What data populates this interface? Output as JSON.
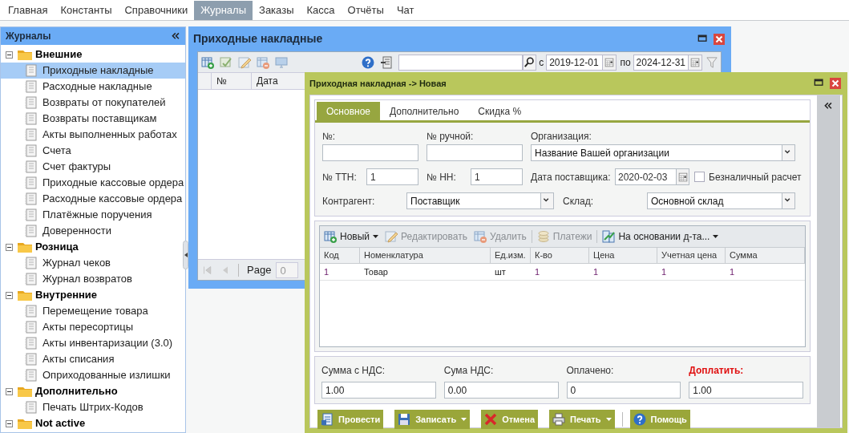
{
  "menu": [
    {
      "label": "Главная",
      "selected": false
    },
    {
      "label": "Константы",
      "selected": false
    },
    {
      "label": "Справочники",
      "selected": false
    },
    {
      "label": "Журналы",
      "selected": true
    },
    {
      "label": "Заказы",
      "selected": false
    },
    {
      "label": "Касса",
      "selected": false
    },
    {
      "label": "Отчёты",
      "selected": false
    },
    {
      "label": "Чат",
      "selected": false
    }
  ],
  "sidebar": {
    "title": "Журналы",
    "tree": [
      {
        "label": "Внешние",
        "expanded": true,
        "children": [
          {
            "label": "Приходные накладные",
            "selected": true
          },
          {
            "label": "Расходные накладные",
            "selected": false
          },
          {
            "label": "Возвраты от покупателей",
            "selected": false
          },
          {
            "label": "Возвраты поставщикам",
            "selected": false
          },
          {
            "label": "Акты выполненных работах",
            "selected": false
          },
          {
            "label": "Счета",
            "selected": false
          },
          {
            "label": "Счет фактуры",
            "selected": false
          },
          {
            "label": "Приходные кассовые ордера",
            "selected": false
          },
          {
            "label": "Расходные кассовые ордера",
            "selected": false
          },
          {
            "label": "Платёжные поручения",
            "selected": false
          },
          {
            "label": "Доверенности",
            "selected": false
          }
        ]
      },
      {
        "label": "Розница",
        "expanded": true,
        "children": [
          {
            "label": "Журнал чеков",
            "selected": false
          },
          {
            "label": "Журнал возвратов",
            "selected": false
          }
        ]
      },
      {
        "label": "Внутренние",
        "expanded": true,
        "children": [
          {
            "label": "Перемещение товара",
            "selected": false
          },
          {
            "label": "Акты пересортицы",
            "selected": false
          },
          {
            "label": "Акты инвентаризации (3.0)",
            "selected": false
          },
          {
            "label": "Акты списания",
            "selected": false
          },
          {
            "label": "Оприходованные излишки",
            "selected": false
          }
        ]
      },
      {
        "label": "Дополнительно",
        "expanded": true,
        "children": [
          {
            "label": "Печать Штрих-Кодов",
            "selected": false
          }
        ]
      },
      {
        "label": "Not active",
        "expanded": true
      }
    ]
  },
  "journal_window": {
    "title": "Приходные накладные",
    "date_from_label": "с",
    "date_from": "2019-12-01",
    "date_to_label": "по",
    "date_to": "2024-12-31",
    "columns": [
      "№",
      "Дата"
    ],
    "page_label": "Page",
    "page": "0"
  },
  "document_window": {
    "title": "Приходная накладная -> Новая",
    "tabs": [
      {
        "label": "Основное",
        "selected": true
      },
      {
        "label": "Дополнительно",
        "selected": false
      },
      {
        "label": "Скидка %",
        "selected": false
      }
    ],
    "number_label": "№:",
    "manual_number_label": "№ ручной:",
    "organization_label": "Организация:",
    "organization": "Название Вашей организации",
    "ttn_label": "№ ТТН:",
    "ttn": "1",
    "nn_label": "№ НН:",
    "nn": "1",
    "supplier_date_label": "Дата поставщика:",
    "supplier_date": "2020-02-03",
    "cashless": {
      "label": "Безналичный расчет",
      "checked": false
    },
    "counterparty_label": "Контрагент:",
    "counterparty": "Поставщик",
    "warehouse_label": "Склад:",
    "warehouse": "Основной склад",
    "grid_toolbar": [
      {
        "kind": "add",
        "label": "Новый",
        "disabled": false,
        "menu": true
      },
      {
        "kind": "edit",
        "label": "Редактировать",
        "disabled": true,
        "menu": false
      },
      {
        "kind": "delete",
        "label": "Удалить",
        "disabled": true,
        "menu": false
      },
      {
        "kind": "coins",
        "label": "Платежи",
        "disabled": true,
        "menu": false
      },
      {
        "kind": "link",
        "label": "На основании д-та...",
        "disabled": false,
        "menu": true
      }
    ],
    "columns": [
      {
        "label": "Код",
        "numeric": true
      },
      {
        "label": "Номенклатура",
        "numeric": false
      },
      {
        "label": "Ед.изм.",
        "numeric": false
      },
      {
        "label": "К-во",
        "numeric": true
      },
      {
        "label": "Цена",
        "numeric": true
      },
      {
        "label": "Учетная цена",
        "numeric": true
      },
      {
        "label": "Сумма",
        "numeric": true
      }
    ],
    "rows": [
      [
        "1",
        "Товар",
        "шт",
        "1",
        "1",
        "1",
        "1"
      ]
    ],
    "totals": [
      {
        "label": "Сумма с НДС:",
        "value": "1.00",
        "highlight": false
      },
      {
        "label": "Сума НДС:",
        "value": "0.00",
        "highlight": false
      },
      {
        "label": "Оплачено:",
        "value": "0",
        "highlight": false
      },
      {
        "label": "Доплатить:",
        "value": "1.00",
        "highlight": true
      }
    ],
    "actions": [
      {
        "kind": "post",
        "label": "Провести",
        "menu": false
      },
      {
        "kind": "save",
        "label": "Записать",
        "menu": true
      },
      {
        "kind": "cancel",
        "label": "Отмена",
        "menu": false
      },
      {
        "kind": "print",
        "label": "Печать",
        "menu": true
      },
      {
        "kind": "help",
        "label": "Помощь",
        "menu": false
      }
    ]
  }
}
